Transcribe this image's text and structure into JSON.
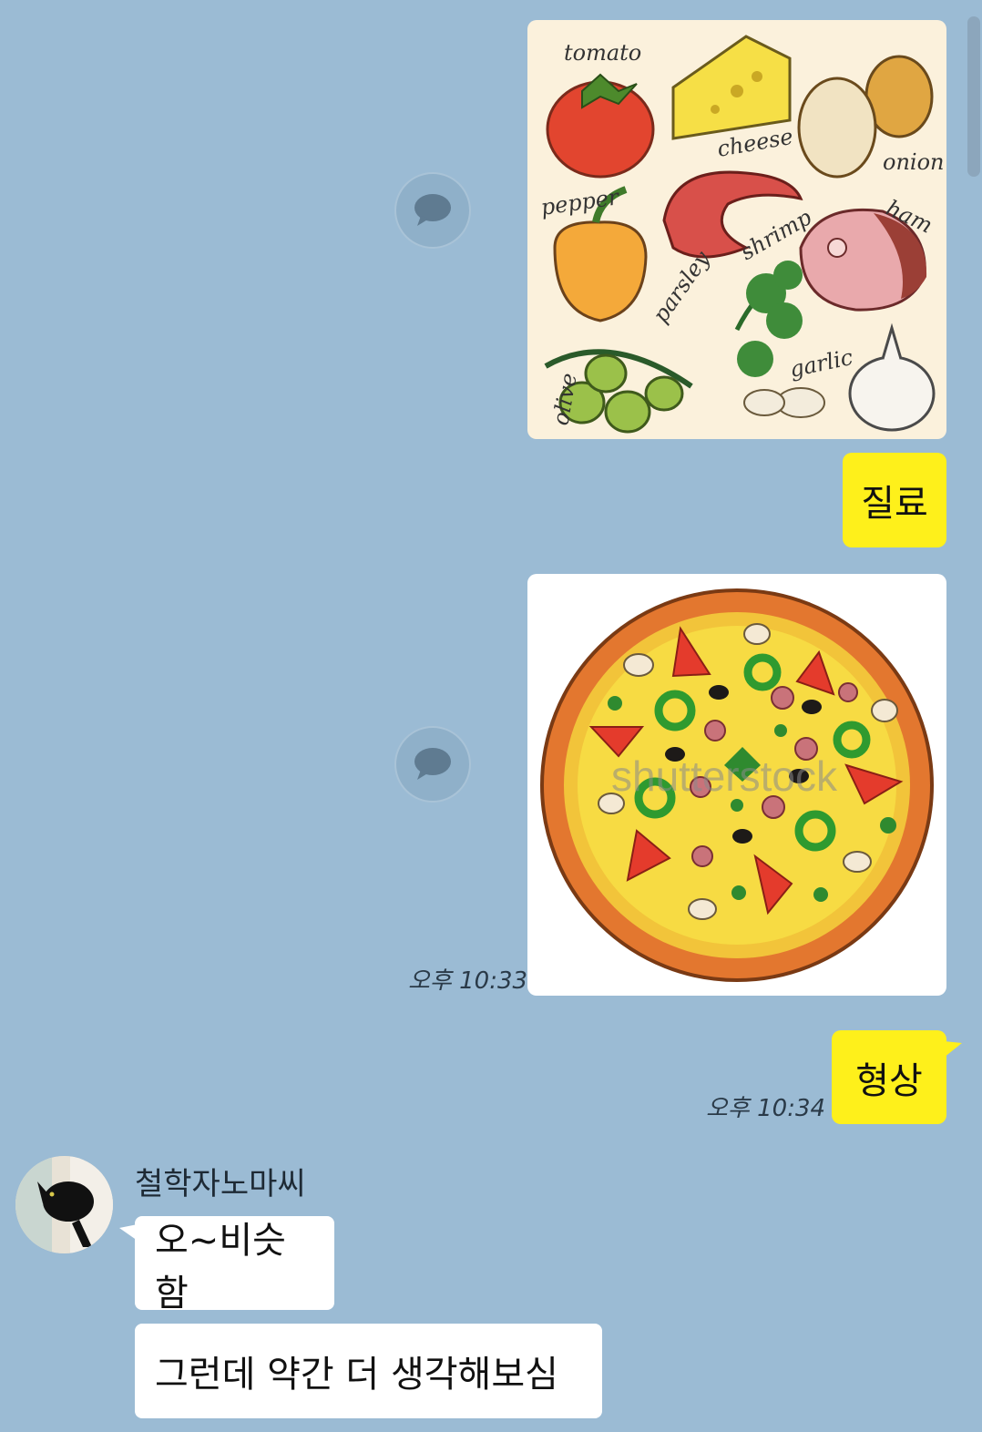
{
  "messages": {
    "ingredients_caption": "질료",
    "shape_caption": "형상",
    "time_pizza": "오후 10:33",
    "time_shape": "오후 10:34",
    "sender_name": "철학자노마씨",
    "reply_1": "오~비슷함",
    "reply_2": "그런데 약간 더 생각해보심"
  },
  "ingredients_image": {
    "labels": {
      "tomato": "tomato",
      "cheese": "cheese",
      "onion": "onion",
      "pepper": "pepper",
      "shrimp": "shrimp",
      "ham": "ham",
      "parsley": "parsley",
      "garlic": "garlic",
      "olive": "olive"
    }
  },
  "pizza_image": {
    "watermark": "shutterstock"
  },
  "colors": {
    "background": "#9bbbd4",
    "my_bubble": "#fef01b",
    "other_bubble": "#ffffff"
  },
  "icons": {
    "share": "speech-bubble-icon"
  }
}
